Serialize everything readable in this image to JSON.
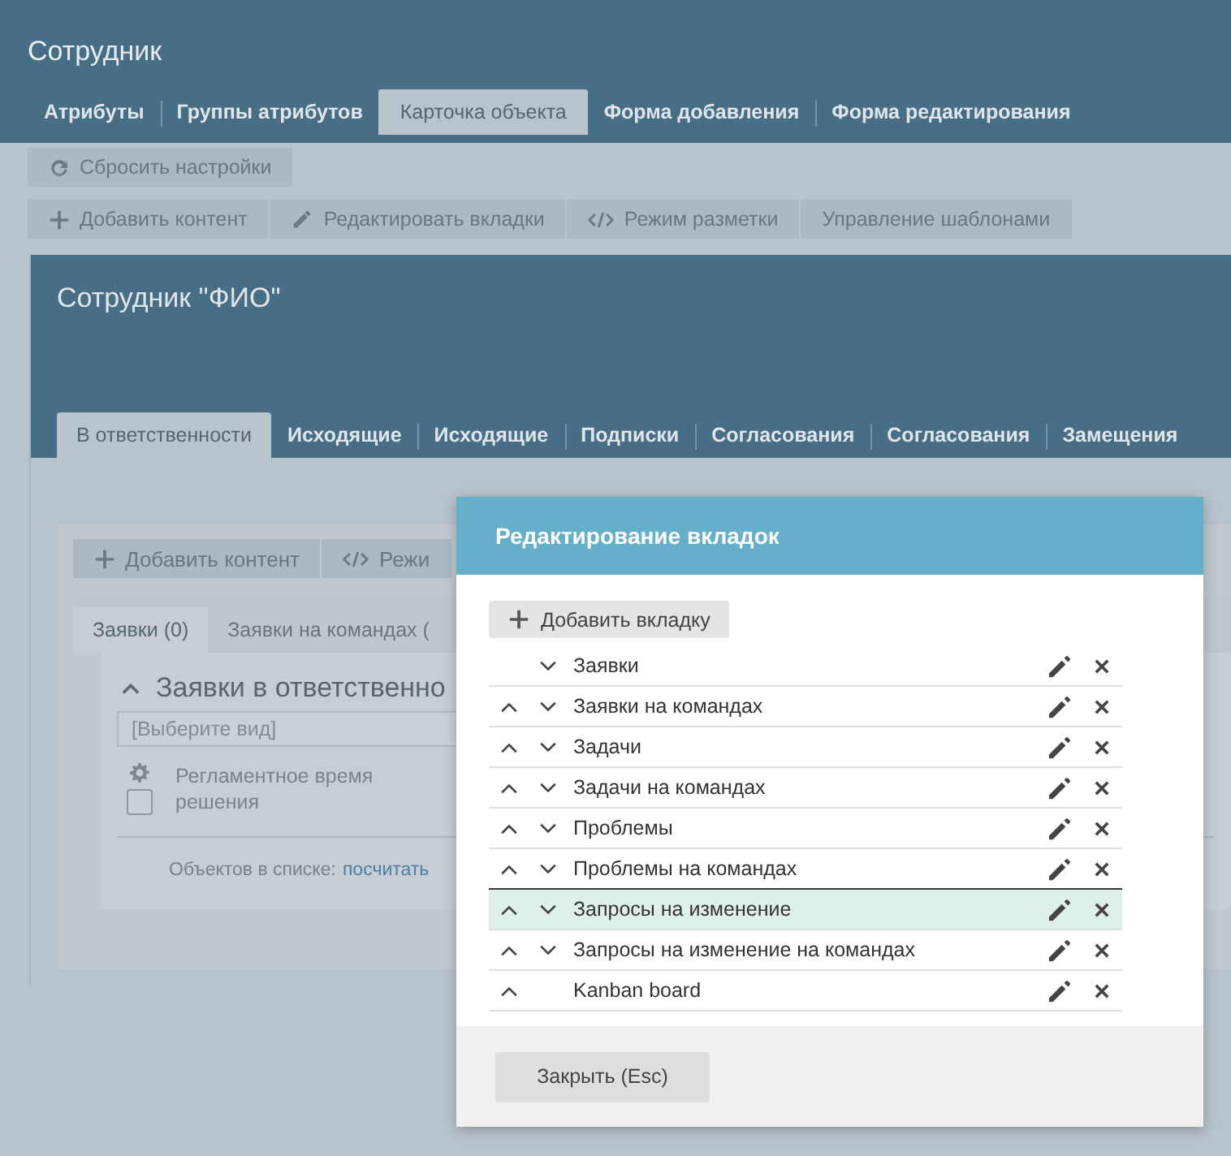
{
  "page": {
    "title": "Сотрудник",
    "tabs": [
      {
        "label": "Атрибуты",
        "selected": false
      },
      {
        "label": "Группы атрибутов",
        "selected": false
      },
      {
        "label": "Карточка объекта",
        "selected": true
      },
      {
        "label": "Форма добавления",
        "selected": false
      },
      {
        "label": "Форма редактирования",
        "selected": false
      }
    ],
    "reset_button": "Сбросить настройки",
    "toolbar": [
      {
        "label": "Добавить контент",
        "kind": "plus"
      },
      {
        "label": "Редактировать вкладки",
        "kind": "pencil"
      },
      {
        "label": "Режим разметки",
        "kind": "code"
      },
      {
        "label": "Управление шаблонами",
        "kind": "text"
      }
    ]
  },
  "card": {
    "title": "Сотрудник \"ФИО\"",
    "tabs": [
      {
        "label": "В ответственности",
        "selected": true
      },
      {
        "label": "Исходящие",
        "selected": false
      },
      {
        "label": "Исходящие",
        "selected": false
      },
      {
        "label": "Подписки",
        "selected": false
      },
      {
        "label": "Согласования",
        "selected": false
      },
      {
        "label": "Согласования",
        "selected": false
      },
      {
        "label": "Замещения",
        "selected": false
      }
    ],
    "inner_toolbar": [
      {
        "label": "Добавить контент",
        "kind": "plus"
      },
      {
        "label": "Режи",
        "kind": "code"
      }
    ],
    "inner_tabs": [
      {
        "label": "Заявки (0)",
        "selected": true
      },
      {
        "label": "Заявки на командах (",
        "selected": false
      }
    ],
    "list": {
      "title": "Заявки в ответственно",
      "view_placeholder": "[Выберите вид]",
      "column_1": "Регламентное время решения",
      "checked": false,
      "footer_label": "Объектов в списке:",
      "footer_link": "посчитать"
    }
  },
  "dialog": {
    "title": "Редактирование вкладок",
    "add_button": "Добавить вкладку",
    "rows": [
      {
        "label": "Заявки",
        "can_move_up": false,
        "can_move_down": true,
        "selected": false
      },
      {
        "label": "Заявки на командах",
        "can_move_up": true,
        "can_move_down": true,
        "selected": false
      },
      {
        "label": "Задачи",
        "can_move_up": true,
        "can_move_down": true,
        "selected": false
      },
      {
        "label": "Задачи на командах",
        "can_move_up": true,
        "can_move_down": true,
        "selected": false
      },
      {
        "label": "Проблемы",
        "can_move_up": true,
        "can_move_down": true,
        "selected": false
      },
      {
        "label": "Проблемы на командах",
        "can_move_up": true,
        "can_move_down": true,
        "selected": false
      },
      {
        "label": "Запросы на изменение",
        "can_move_up": true,
        "can_move_down": true,
        "selected": true
      },
      {
        "label": "Запросы на изменение на командах",
        "can_move_up": true,
        "can_move_down": true,
        "selected": false
      },
      {
        "label": "Kanban board",
        "can_move_up": true,
        "can_move_down": false,
        "selected": false
      }
    ],
    "close_button": "Закрыть (Esc)"
  }
}
